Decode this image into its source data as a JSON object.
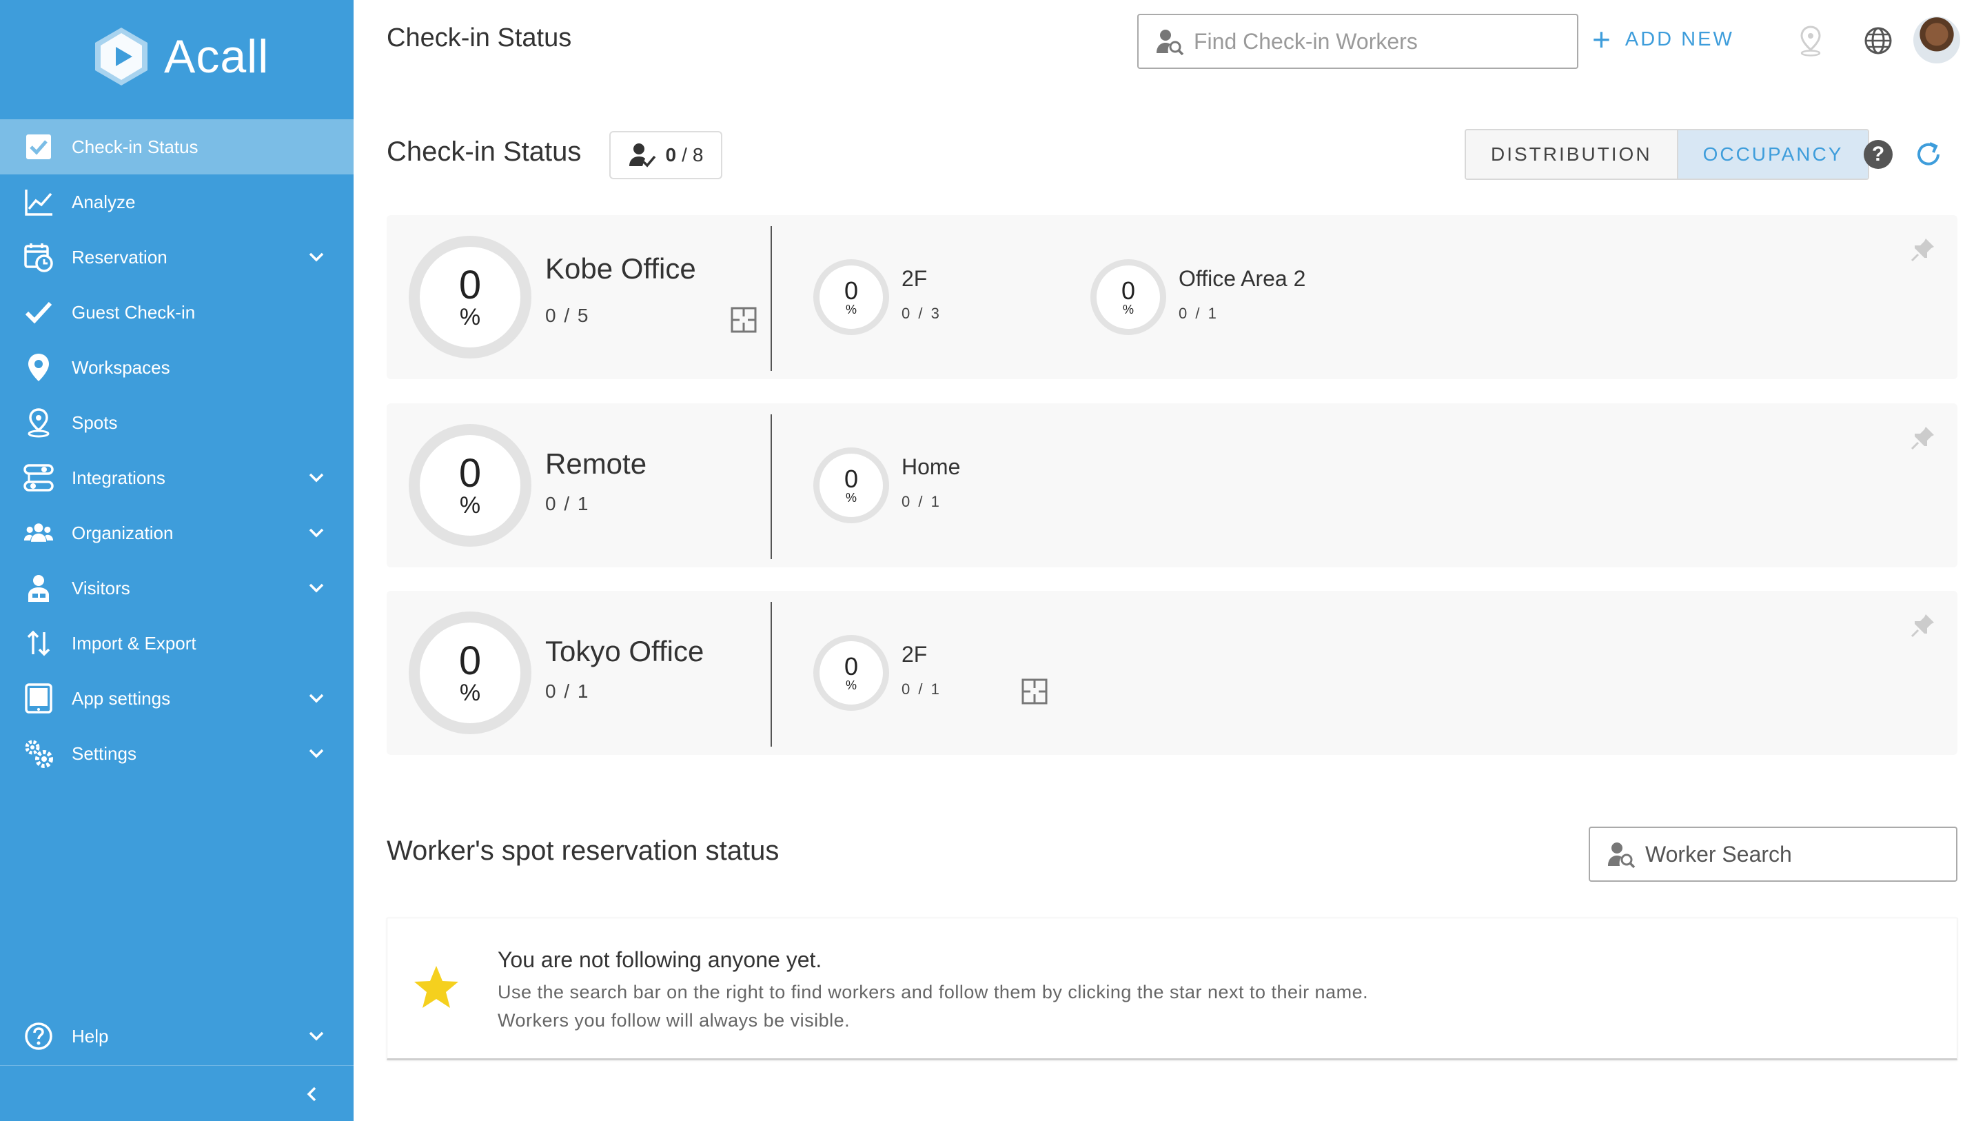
{
  "app": {
    "name": "Acall",
    "header_title": "Check-in Status"
  },
  "colors": {
    "sidebar": "#3e9ddb",
    "active_item": "#7bbde6",
    "accent": "#3e9ddb",
    "star": "#f5d01e"
  },
  "sidebar": {
    "items": [
      {
        "label": "Check-in Status",
        "icon": "checkbox-icon",
        "active": true,
        "has_submenu": false
      },
      {
        "label": "Analyze",
        "icon": "chart-line-icon",
        "has_submenu": false
      },
      {
        "label": "Reservation",
        "icon": "calendar-clock-icon",
        "has_submenu": true
      },
      {
        "label": "Guest Check-in",
        "icon": "check-icon",
        "has_submenu": false
      },
      {
        "label": "Workspaces",
        "icon": "location-pin-icon",
        "has_submenu": false
      },
      {
        "label": "Spots",
        "icon": "map-pin-icon",
        "has_submenu": false
      },
      {
        "label": "Integrations",
        "icon": "integrations-icon",
        "has_submenu": true
      },
      {
        "label": "Organization",
        "icon": "people-icon",
        "has_submenu": true
      },
      {
        "label": "Visitors",
        "icon": "visitor-icon",
        "has_submenu": true
      },
      {
        "label": "Import & Export",
        "icon": "import-export-icon",
        "has_submenu": false
      },
      {
        "label": "App settings",
        "icon": "tablet-icon",
        "has_submenu": true
      },
      {
        "label": "Settings",
        "icon": "gears-icon",
        "has_submenu": true
      }
    ],
    "help": {
      "label": "Help",
      "icon": "help-circle-icon"
    },
    "collapse_icon": "chevron-left-icon"
  },
  "header": {
    "search_placeholder": "Find Check-in Workers",
    "add_new_label": "ADD NEW",
    "icons": [
      "location-off-icon",
      "globe-icon",
      "avatar"
    ]
  },
  "checkin": {
    "title": "Check-in Status",
    "count": {
      "checked_in": "0",
      "total": "8"
    },
    "view_toggle": {
      "options": [
        "DISTRIBUTION",
        "OCCUPANCY"
      ],
      "selected": "OCCUPANCY"
    },
    "locations": [
      {
        "name": "Kobe Office",
        "percent": "0",
        "count": "0 / 5",
        "has_floorplan": true,
        "areas": [
          {
            "name": "2F",
            "percent": "0",
            "count": "0 / 3",
            "has_floorplan": false
          },
          {
            "name": "Office Area 2",
            "percent": "0",
            "count": "0 / 1",
            "has_floorplan": false
          }
        ]
      },
      {
        "name": "Remote",
        "percent": "0",
        "count": "0 / 1",
        "has_floorplan": false,
        "areas": [
          {
            "name": "Home",
            "percent": "0",
            "count": "0 / 1",
            "has_floorplan": false
          }
        ]
      },
      {
        "name": "Tokyo Office",
        "percent": "0",
        "count": "0 / 1",
        "has_floorplan": false,
        "areas": [
          {
            "name": "2F",
            "percent": "0",
            "count": "0 / 1",
            "has_floorplan": true
          }
        ]
      }
    ]
  },
  "workers": {
    "title": "Worker's spot reservation status",
    "search_placeholder": "Worker Search",
    "empty": {
      "title": "You are not following anyone yet.",
      "line1": "Use the search bar on the right to find workers and follow them by clicking the star next to their name.",
      "line2": "Workers you follow will always be visible."
    }
  }
}
